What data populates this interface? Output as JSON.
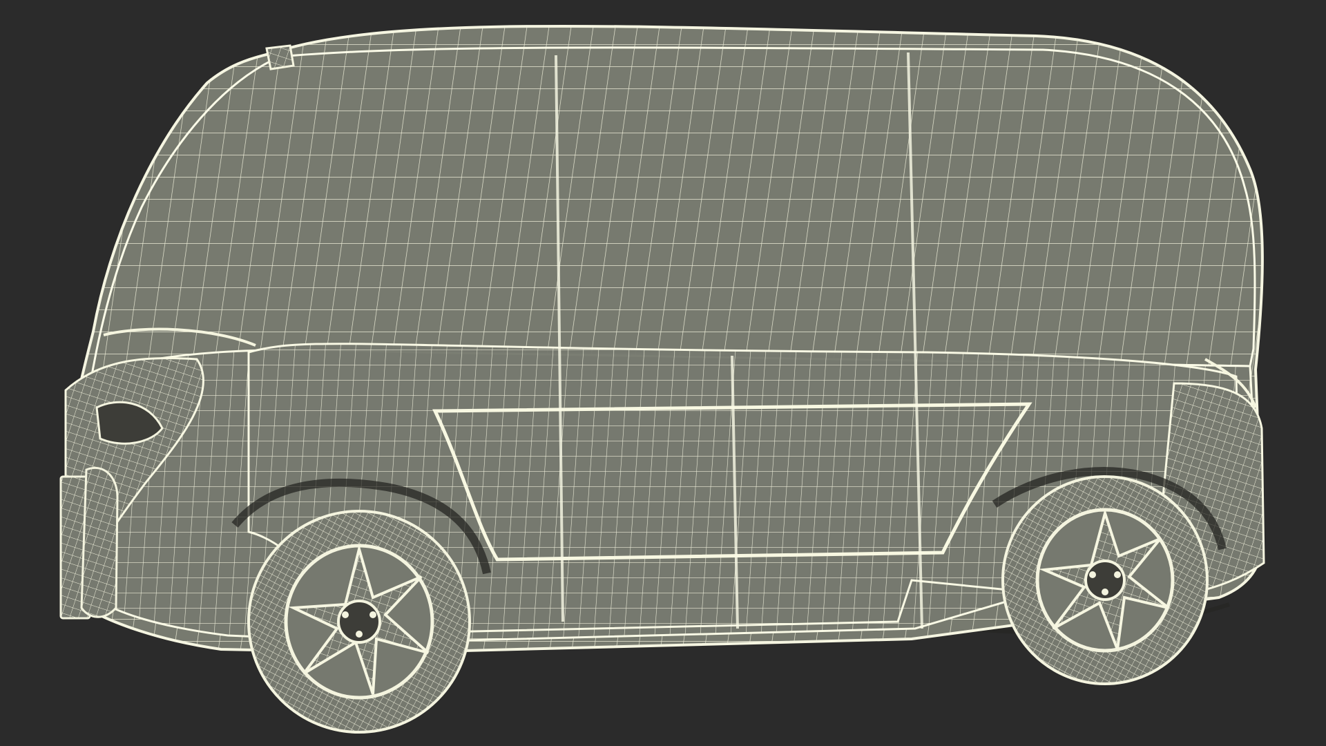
{
  "scene": {
    "subject": "wireframe-minibus",
    "background_color": "#2b2b2b",
    "surface_color": "#777a6f",
    "wire_color": "#f2f2dc",
    "tire_color": "#75786e",
    "dark_detail_color": "#3d3d38"
  }
}
